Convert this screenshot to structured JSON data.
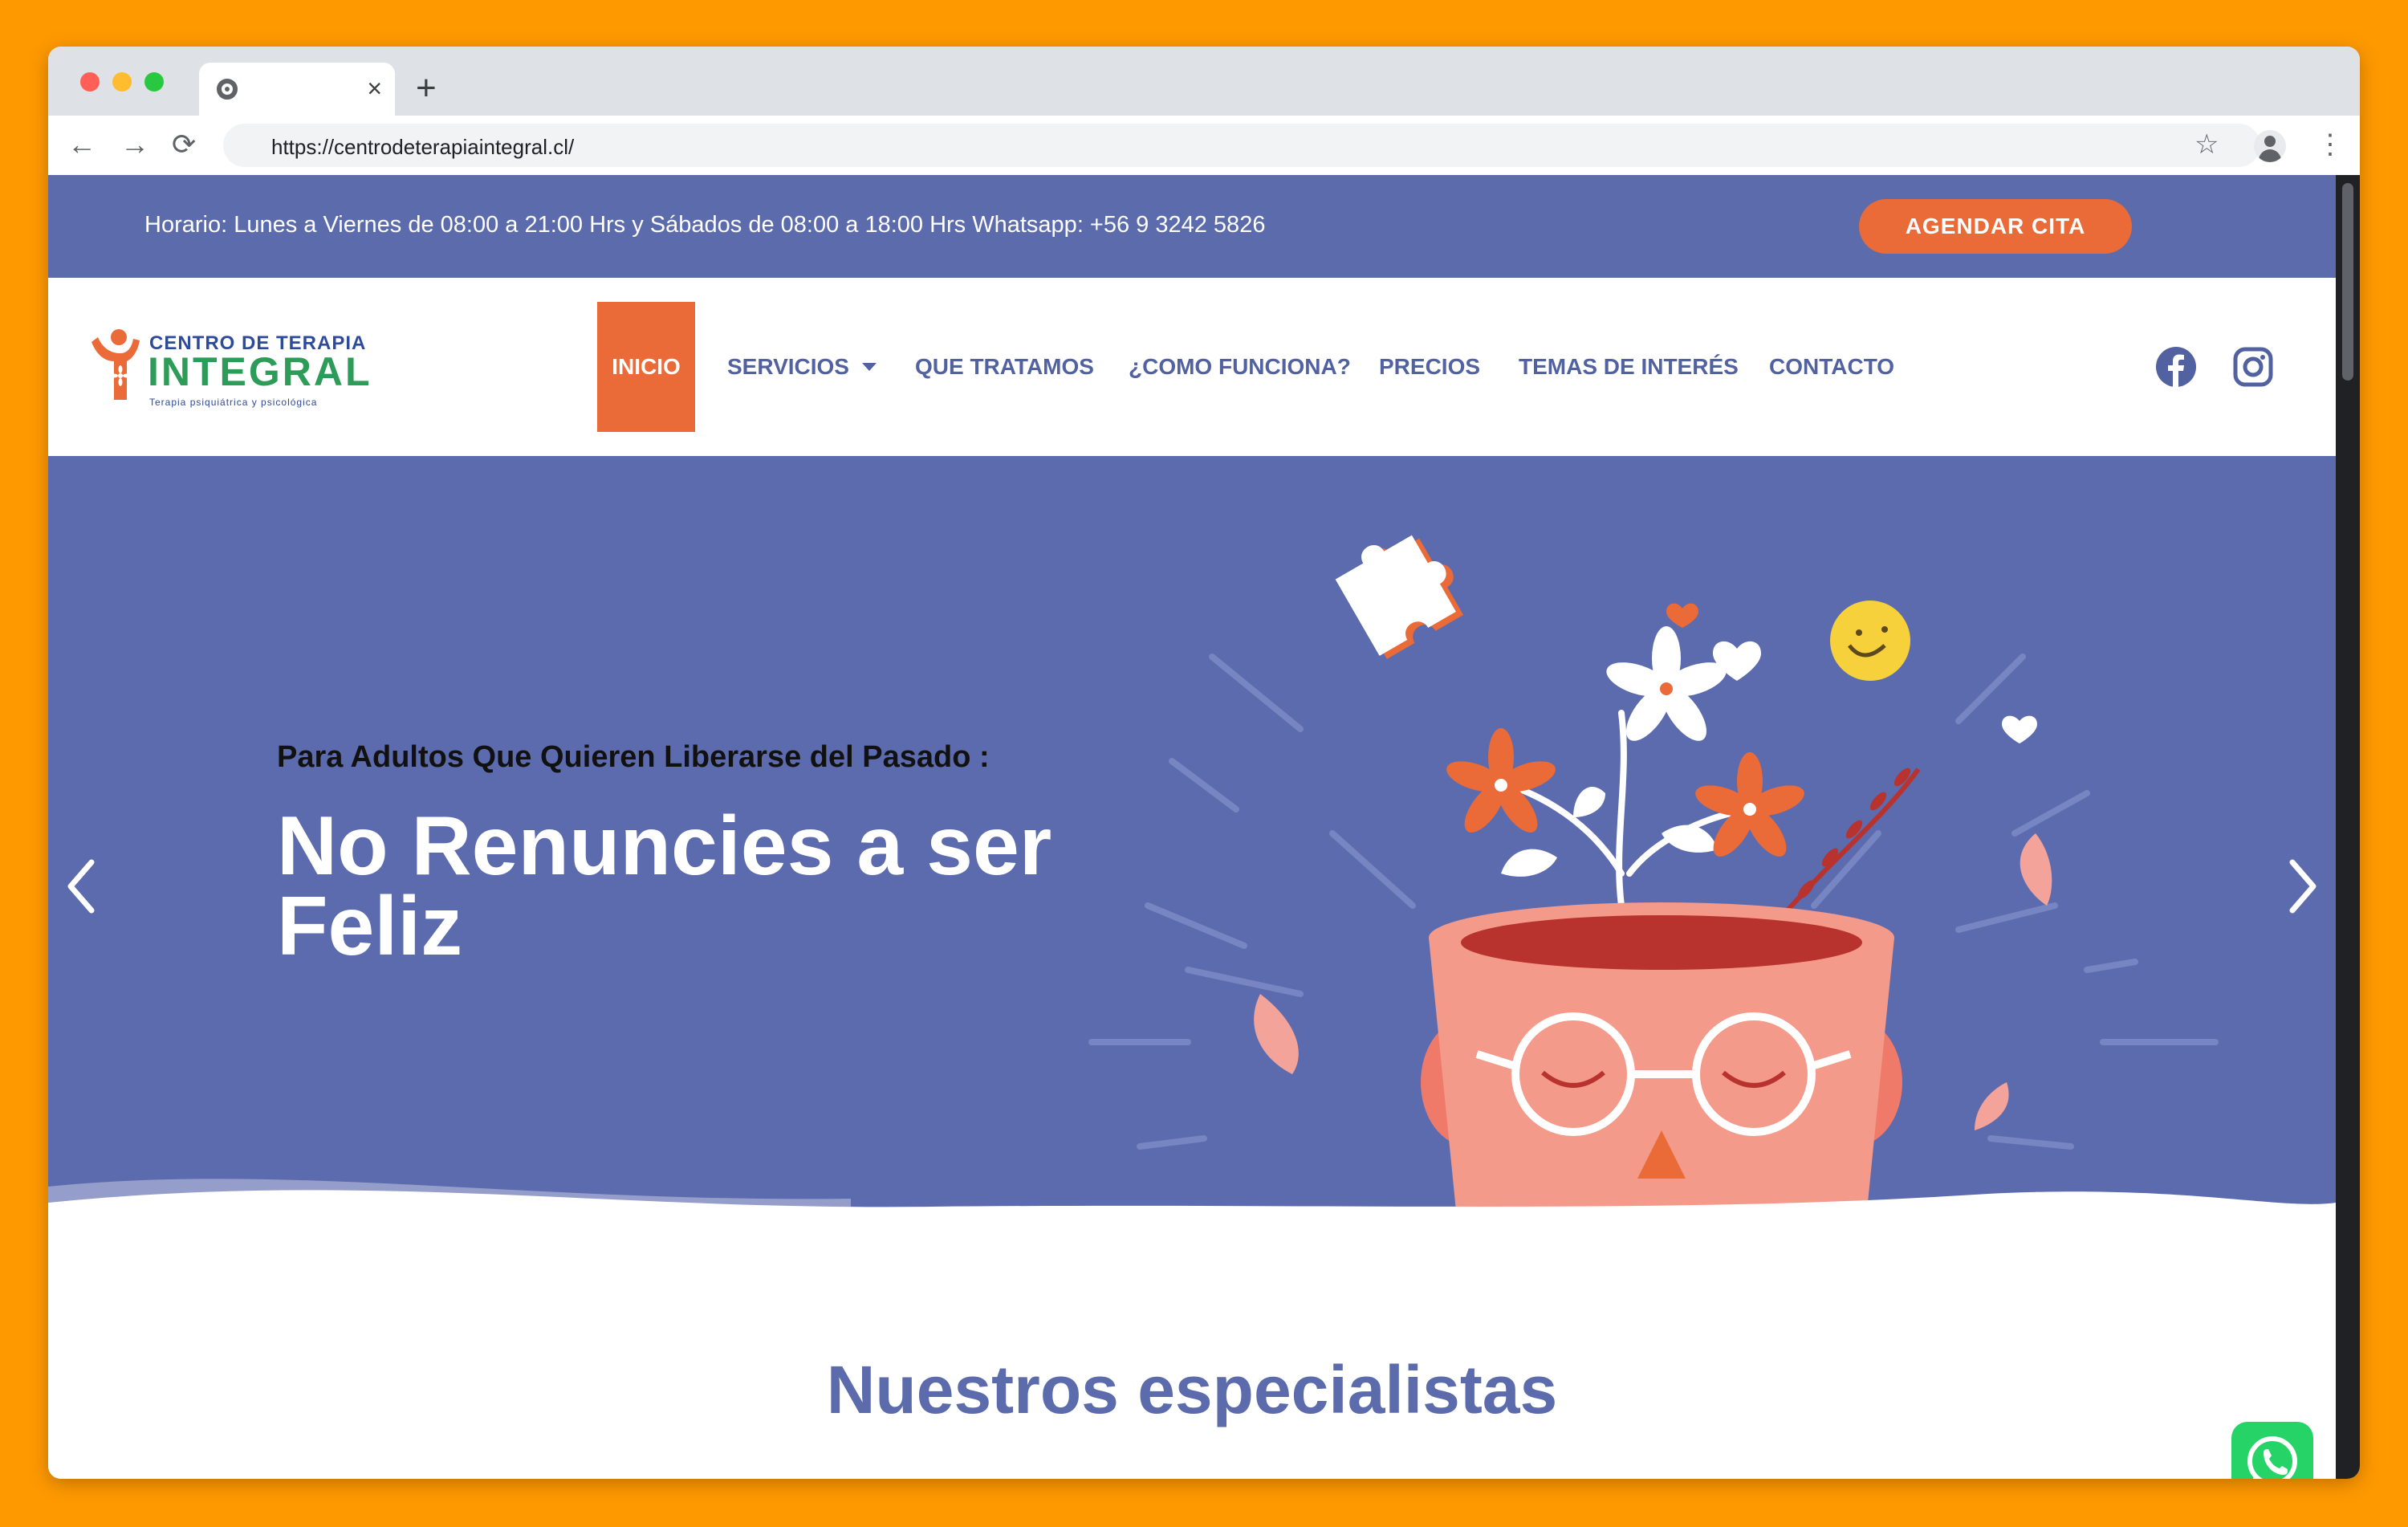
{
  "browser": {
    "tab_close": "×",
    "new_tab": "+",
    "url": "https://centrodeterapiaintegral.cl/",
    "nav": {
      "back": "←",
      "forward": "→",
      "reload": "⟳"
    },
    "bookmark": "☆",
    "menu": "⋮",
    "traffic_colors": [
      "#FF5F57",
      "#FEBC2E",
      "#28C840"
    ]
  },
  "topbar": {
    "info": "Horario: Lunes a Viernes de 08:00 a 21:00 Hrs y Sábados de 08:00 a 18:00 Hrs Whatsapp: +56 9 3242 5826",
    "cta": "AGENDAR CITA"
  },
  "logo": {
    "line1": "CENTRO DE TERAPIA",
    "line2": "INTEGRAL",
    "line3": "Terapia psiquiátrica y psicológica"
  },
  "nav": {
    "items": [
      {
        "label": "INICIO",
        "active": true
      },
      {
        "label": "SERVICIOS",
        "has_dropdown": true
      },
      {
        "label": "QUE TRATAMOS"
      },
      {
        "label": "¿COMO FUNCIONA?"
      },
      {
        "label": "PRECIOS"
      },
      {
        "label": "TEMAS DE INTERÉS"
      },
      {
        "label": "CONTACTO"
      }
    ],
    "social_icons": [
      "facebook-icon",
      "instagram-icon"
    ]
  },
  "hero": {
    "subtitle": "Para Adultos Que Quieren Liberarse del Pasado :",
    "title_line1": "No Renuncies a ser",
    "title_line2": "Feliz"
  },
  "section": {
    "title": "Nuestros especialistas"
  },
  "colors": {
    "accent": "#EA6A38",
    "brand": "#5C6BAB",
    "outer_background": "#FF9900",
    "whatsapp": "#25D366"
  }
}
